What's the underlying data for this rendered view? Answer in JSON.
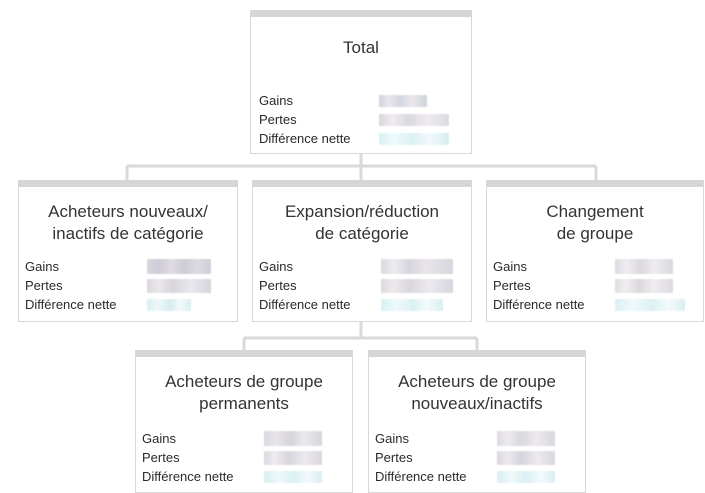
{
  "diagram": {
    "root": {
      "title": "Total",
      "metrics": {
        "gains": "Gains",
        "losses": "Pertes",
        "net_difference": "Différence nette"
      }
    },
    "level_two": {
      "buyers_new_inactive_category": {
        "title": "Acheteurs  nouveaux/\ninactifs de catégorie",
        "metrics": {
          "gains": "Gains",
          "losses": "Pertes",
          "net_difference": "Différence nette"
        }
      },
      "expansion_reduction_category": {
        "title": "Expansion/réduction\nde catégorie",
        "metrics": {
          "gains": "Gains",
          "losses": "Pertes",
          "net_difference": "Différence nette"
        }
      },
      "group_change": {
        "title": "Changement\nde groupe",
        "metrics": {
          "gains": "Gains",
          "losses": "Pertes",
          "net_difference": "Différence nette"
        }
      }
    },
    "level_three": {
      "permanent_group_buyers": {
        "title": "Acheteurs de groupe\npermanents",
        "metrics": {
          "gains": "Gains",
          "losses": "Pertes",
          "net_difference": "Différence nette"
        }
      },
      "new_inactive_group_buyers": {
        "title": "Acheteurs de groupe\nnouveaux/inactifs",
        "metrics": {
          "gains": "Gains",
          "losses": "Pertes",
          "net_difference": "Différence nette"
        }
      }
    }
  },
  "colors": {
    "card_top_bar": "#d6d6d6",
    "card_border": "#d8d8d8",
    "connector": "#d9d9d9",
    "text": "#333333",
    "blurred_neutral": "#d6d3dc",
    "blurred_cyan": "#d6eef2"
  }
}
